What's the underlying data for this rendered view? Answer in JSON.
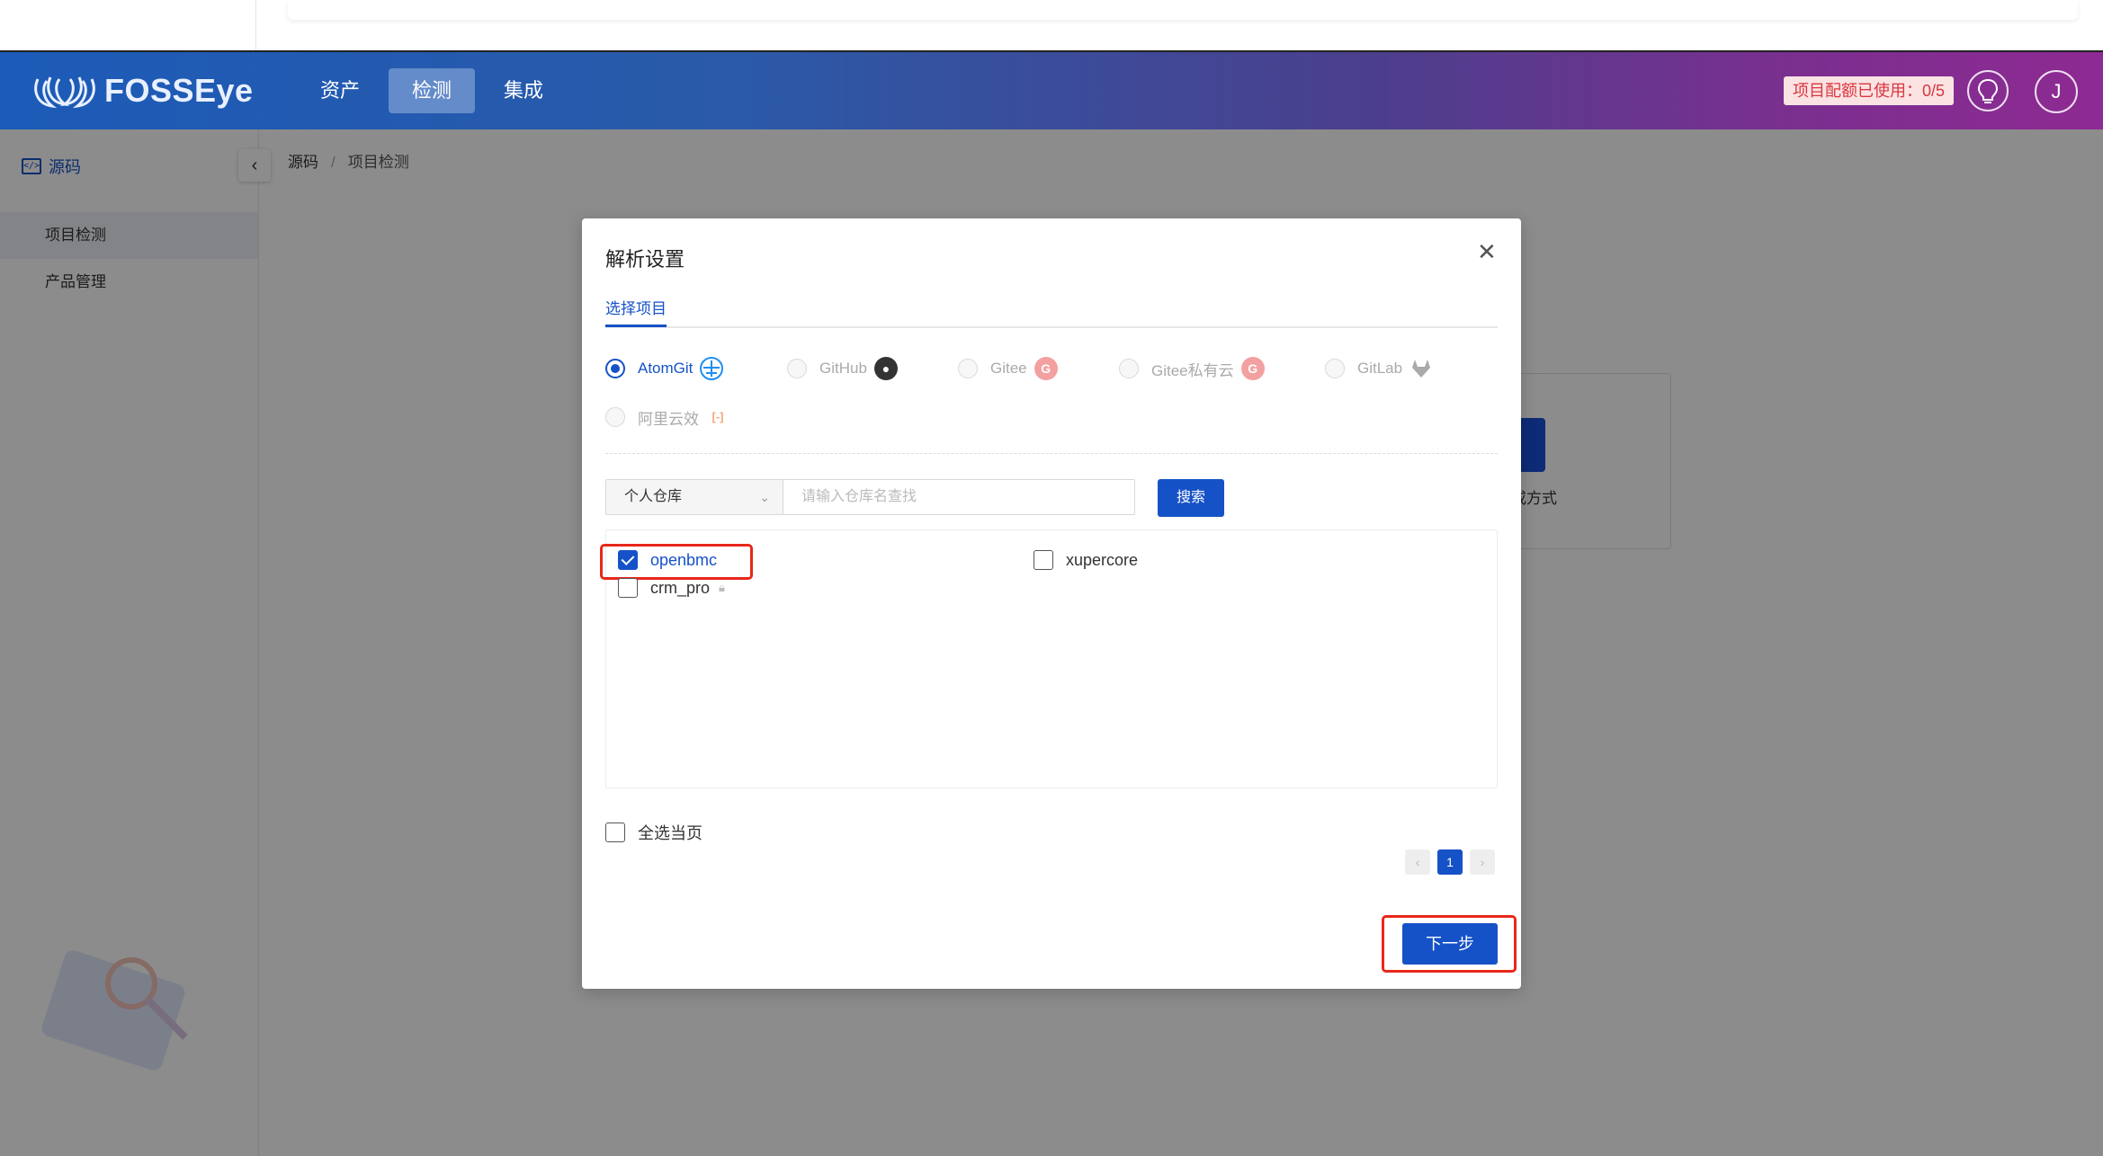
{
  "brand": {
    "name": "FOSSEye"
  },
  "nav": {
    "items": [
      "资产",
      "检测",
      "集成"
    ],
    "active_index": 1
  },
  "header": {
    "quota": "项目配额已使用：0/5",
    "avatar_initial": "J"
  },
  "sidebar": {
    "section": "源码",
    "items": [
      "项目检测",
      "产品管理"
    ],
    "active_index": 0,
    "collapse_glyph": "‹"
  },
  "breadcrumb": {
    "root": "源码",
    "sep": "/",
    "current": "项目检测"
  },
  "background_card": {
    "text_fragment": "或方式"
  },
  "modal": {
    "title": "解析设置",
    "close_glyph": "✕",
    "tab": "选择项目",
    "providers": [
      {
        "label": "AtomGit",
        "selected": true,
        "icon": "atomgit-icon",
        "color": "#1e8ff0"
      },
      {
        "label": "GitHub",
        "selected": false,
        "icon": "github-icon",
        "color": "#333333"
      },
      {
        "label": "Gitee",
        "selected": false,
        "icon": "gitee-icon",
        "color": "#e5484d"
      },
      {
        "label": "Gitee私有云",
        "selected": false,
        "icon": "gitee-icon",
        "color": "#e5484d"
      },
      {
        "label": "GitLab",
        "selected": false,
        "icon": "gitlab-icon",
        "color": "#888888"
      },
      {
        "label": "阿里云效",
        "selected": false,
        "icon": "aliyun-icon",
        "color": "#f07c3a"
      }
    ],
    "repo_type": "个人仓库",
    "search_placeholder": "请输入仓库名查找",
    "search_button": "搜索",
    "repos": [
      {
        "name": "openbmc",
        "checked": true
      },
      {
        "name": "xupercore",
        "checked": false
      },
      {
        "name": "crm_pro",
        "checked": false,
        "private": true
      }
    ],
    "select_all": "全选当页",
    "pagination": {
      "prev": "‹",
      "current": "1",
      "next": "›"
    },
    "next_button": "下一步"
  }
}
